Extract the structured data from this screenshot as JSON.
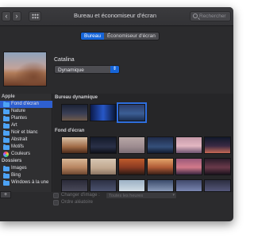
{
  "window": {
    "title": "Bureau et économiseur d'écran",
    "nav_back": "‹",
    "nav_forward": "›"
  },
  "search": {
    "placeholder": "Rechercher"
  },
  "tabs": [
    {
      "label": "Bureau",
      "active": true
    },
    {
      "label": "Économiseur d'écran",
      "active": false
    }
  ],
  "current": {
    "wallpaper_name": "Catalina",
    "mode": "Dynamique",
    "mode_arrows": "⇕"
  },
  "sidebar": {
    "apple_header": "Apple",
    "apple_items": [
      {
        "label": "Fond d'écran",
        "icon": "folder-icon",
        "selected": true
      },
      {
        "label": "Nature",
        "icon": "folder-icon"
      },
      {
        "label": "Plantes",
        "icon": "folder-icon"
      },
      {
        "label": "Art",
        "icon": "folder-icon"
      },
      {
        "label": "Noir et blanc",
        "icon": "folder-icon"
      },
      {
        "label": "Abstrait",
        "icon": "folder-icon"
      },
      {
        "label": "Motifs",
        "icon": "folder-icon"
      },
      {
        "label": "Couleurs",
        "icon": "colors-icon"
      }
    ],
    "folders_header": "Dossiers",
    "folder_items": [
      {
        "label": "Images",
        "icon": "folder-icon"
      },
      {
        "label": "Bing",
        "icon": "folder-icon"
      },
      {
        "label": "Windows à la une",
        "icon": "folder-icon"
      }
    ],
    "add_button": "+"
  },
  "content": {
    "dynamic_header": "Bureau dynamique",
    "wallpaper_header": "Fond d'écran"
  },
  "options": {
    "change_picture_label": "Changer d'image :",
    "interval_value": "Toutes les heures",
    "random_order_label": "Ordre aléatoire"
  },
  "colors": {
    "window_bg": "#2b2b2d",
    "accent": "#1665d8",
    "selection": "#2e5fd0",
    "folder": "#4da3f5"
  }
}
